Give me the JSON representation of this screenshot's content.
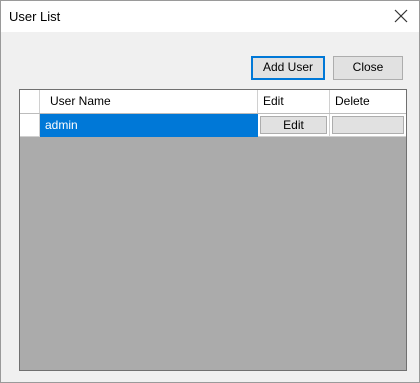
{
  "window": {
    "title": "User List",
    "close_icon": "close-icon"
  },
  "toolbar": {
    "add_user_label": "Add User",
    "close_label": "Close"
  },
  "grid": {
    "columns": [
      "User Name",
      "Edit",
      "Delete"
    ],
    "rows": [
      {
        "user_name": "admin",
        "edit_label": "Edit",
        "delete_label": ""
      }
    ],
    "selection_color": "#0078d7",
    "background_color": "#ababab"
  }
}
